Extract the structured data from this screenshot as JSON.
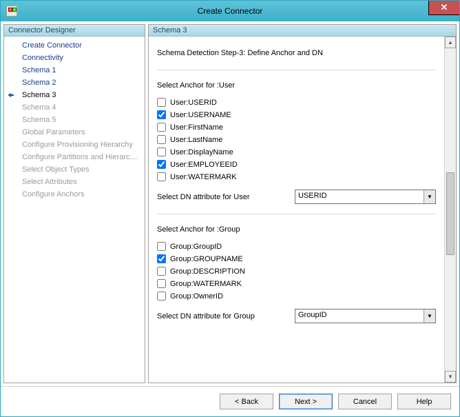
{
  "window": {
    "title": "Create Connector"
  },
  "sidebar": {
    "header": "Connector Designer",
    "items": [
      {
        "label": "Create Connector",
        "state": "normal"
      },
      {
        "label": "Connectivity",
        "state": "normal"
      },
      {
        "label": "Schema 1",
        "state": "normal"
      },
      {
        "label": "Schema 2",
        "state": "normal"
      },
      {
        "label": "Schema 3",
        "state": "current"
      },
      {
        "label": "Schema 4",
        "state": "disabled"
      },
      {
        "label": "Schema 5",
        "state": "disabled"
      },
      {
        "label": "Global Parameters",
        "state": "disabled"
      },
      {
        "label": "Configure Provisioning Hierarchy",
        "state": "disabled"
      },
      {
        "label": "Configure Partitions and Hierarchies",
        "state": "disabled"
      },
      {
        "label": "Select Object Types",
        "state": "disabled"
      },
      {
        "label": "Select Attributes",
        "state": "disabled"
      },
      {
        "label": "Configure Anchors",
        "state": "disabled"
      }
    ]
  },
  "main": {
    "header": "Schema 3",
    "step_title": "Schema Detection Step-3: Define Anchor and DN",
    "user_section": {
      "label": "Select Anchor for :User",
      "checkboxes": [
        {
          "label": "User:USERID",
          "checked": false
        },
        {
          "label": "User:USERNAME",
          "checked": true
        },
        {
          "label": "User:FirstName",
          "checked": false
        },
        {
          "label": "User:LastName",
          "checked": false
        },
        {
          "label": "User:DisplayName",
          "checked": false
        },
        {
          "label": "User:EMPLOYEEID",
          "checked": true
        },
        {
          "label": "User:WATERMARK",
          "checked": false
        }
      ],
      "dn_label": "Select DN attribute for User",
      "dn_value": "USERID"
    },
    "group_section": {
      "label": "Select Anchor for :Group",
      "checkboxes": [
        {
          "label": "Group:GroupID",
          "checked": false
        },
        {
          "label": "Group:GROUPNAME",
          "checked": true
        },
        {
          "label": "Group:DESCRIPTION",
          "checked": false
        },
        {
          "label": "Group:WATERMARK",
          "checked": false
        },
        {
          "label": "Group:OwnerID",
          "checked": false
        }
      ],
      "dn_label": "Select DN attribute for Group",
      "dn_value": "GroupID"
    }
  },
  "footer": {
    "back": "<  Back",
    "next": "Next  >",
    "cancel": "Cancel",
    "help": "Help"
  }
}
